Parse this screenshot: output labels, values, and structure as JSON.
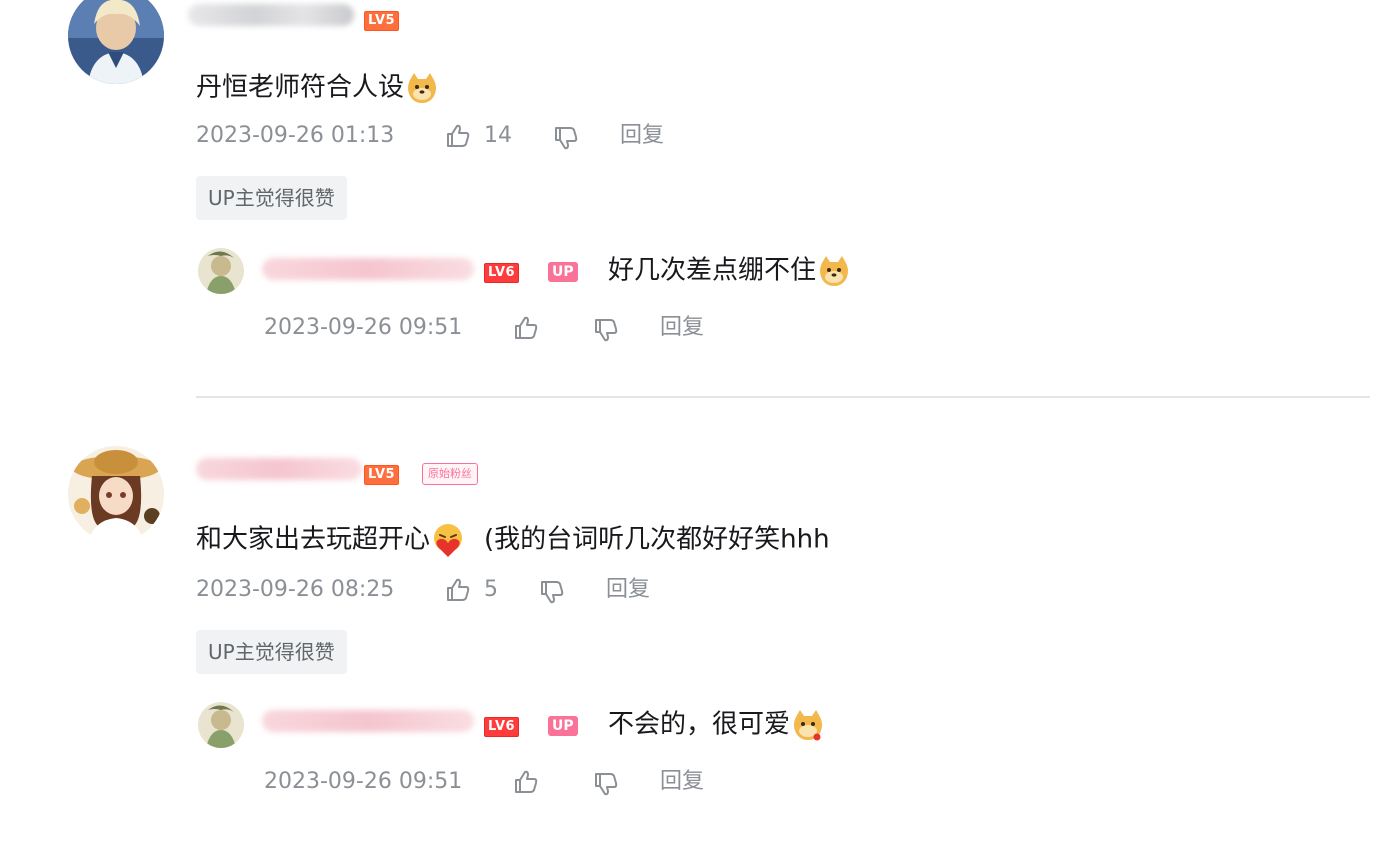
{
  "comments": [
    {
      "username": "",
      "level": "LV5",
      "content": "丹恒老师符合人设",
      "emoji": "doge-emoji",
      "time": "2023-09-26 01:13",
      "likes": "14",
      "reply_label": "回复",
      "up_liked_label": "UP主觉得很赞",
      "reply": {
        "username": "",
        "level": "LV6",
        "up_badge": "UP",
        "content": "好几次差点绷不住",
        "emoji": "doge-emoji",
        "time": "2023-09-26 09:51",
        "reply_label": "回复"
      }
    },
    {
      "username": "",
      "level": "LV5",
      "fan_badge": "原始粉丝",
      "content_before": "和大家出去玩超开心",
      "emoji": "heart-face-emoji",
      "content_after": "(我的台词听几次都好好笑hhh",
      "time": "2023-09-26 08:25",
      "likes": "5",
      "reply_label": "回复",
      "up_liked_label": "UP主觉得很赞",
      "reply": {
        "username": "",
        "level": "LV6",
        "up_badge": "UP",
        "content": "不会的，很可爱",
        "emoji": "doge-emoji",
        "time": "2023-09-26 09:51",
        "reply_label": "回复"
      }
    }
  ],
  "colors": {
    "accent_pink": "#fb7299",
    "level_orange": "#ff6f3d",
    "level_red": "#ff3b3b",
    "meta_gray": "#8b8f96"
  }
}
